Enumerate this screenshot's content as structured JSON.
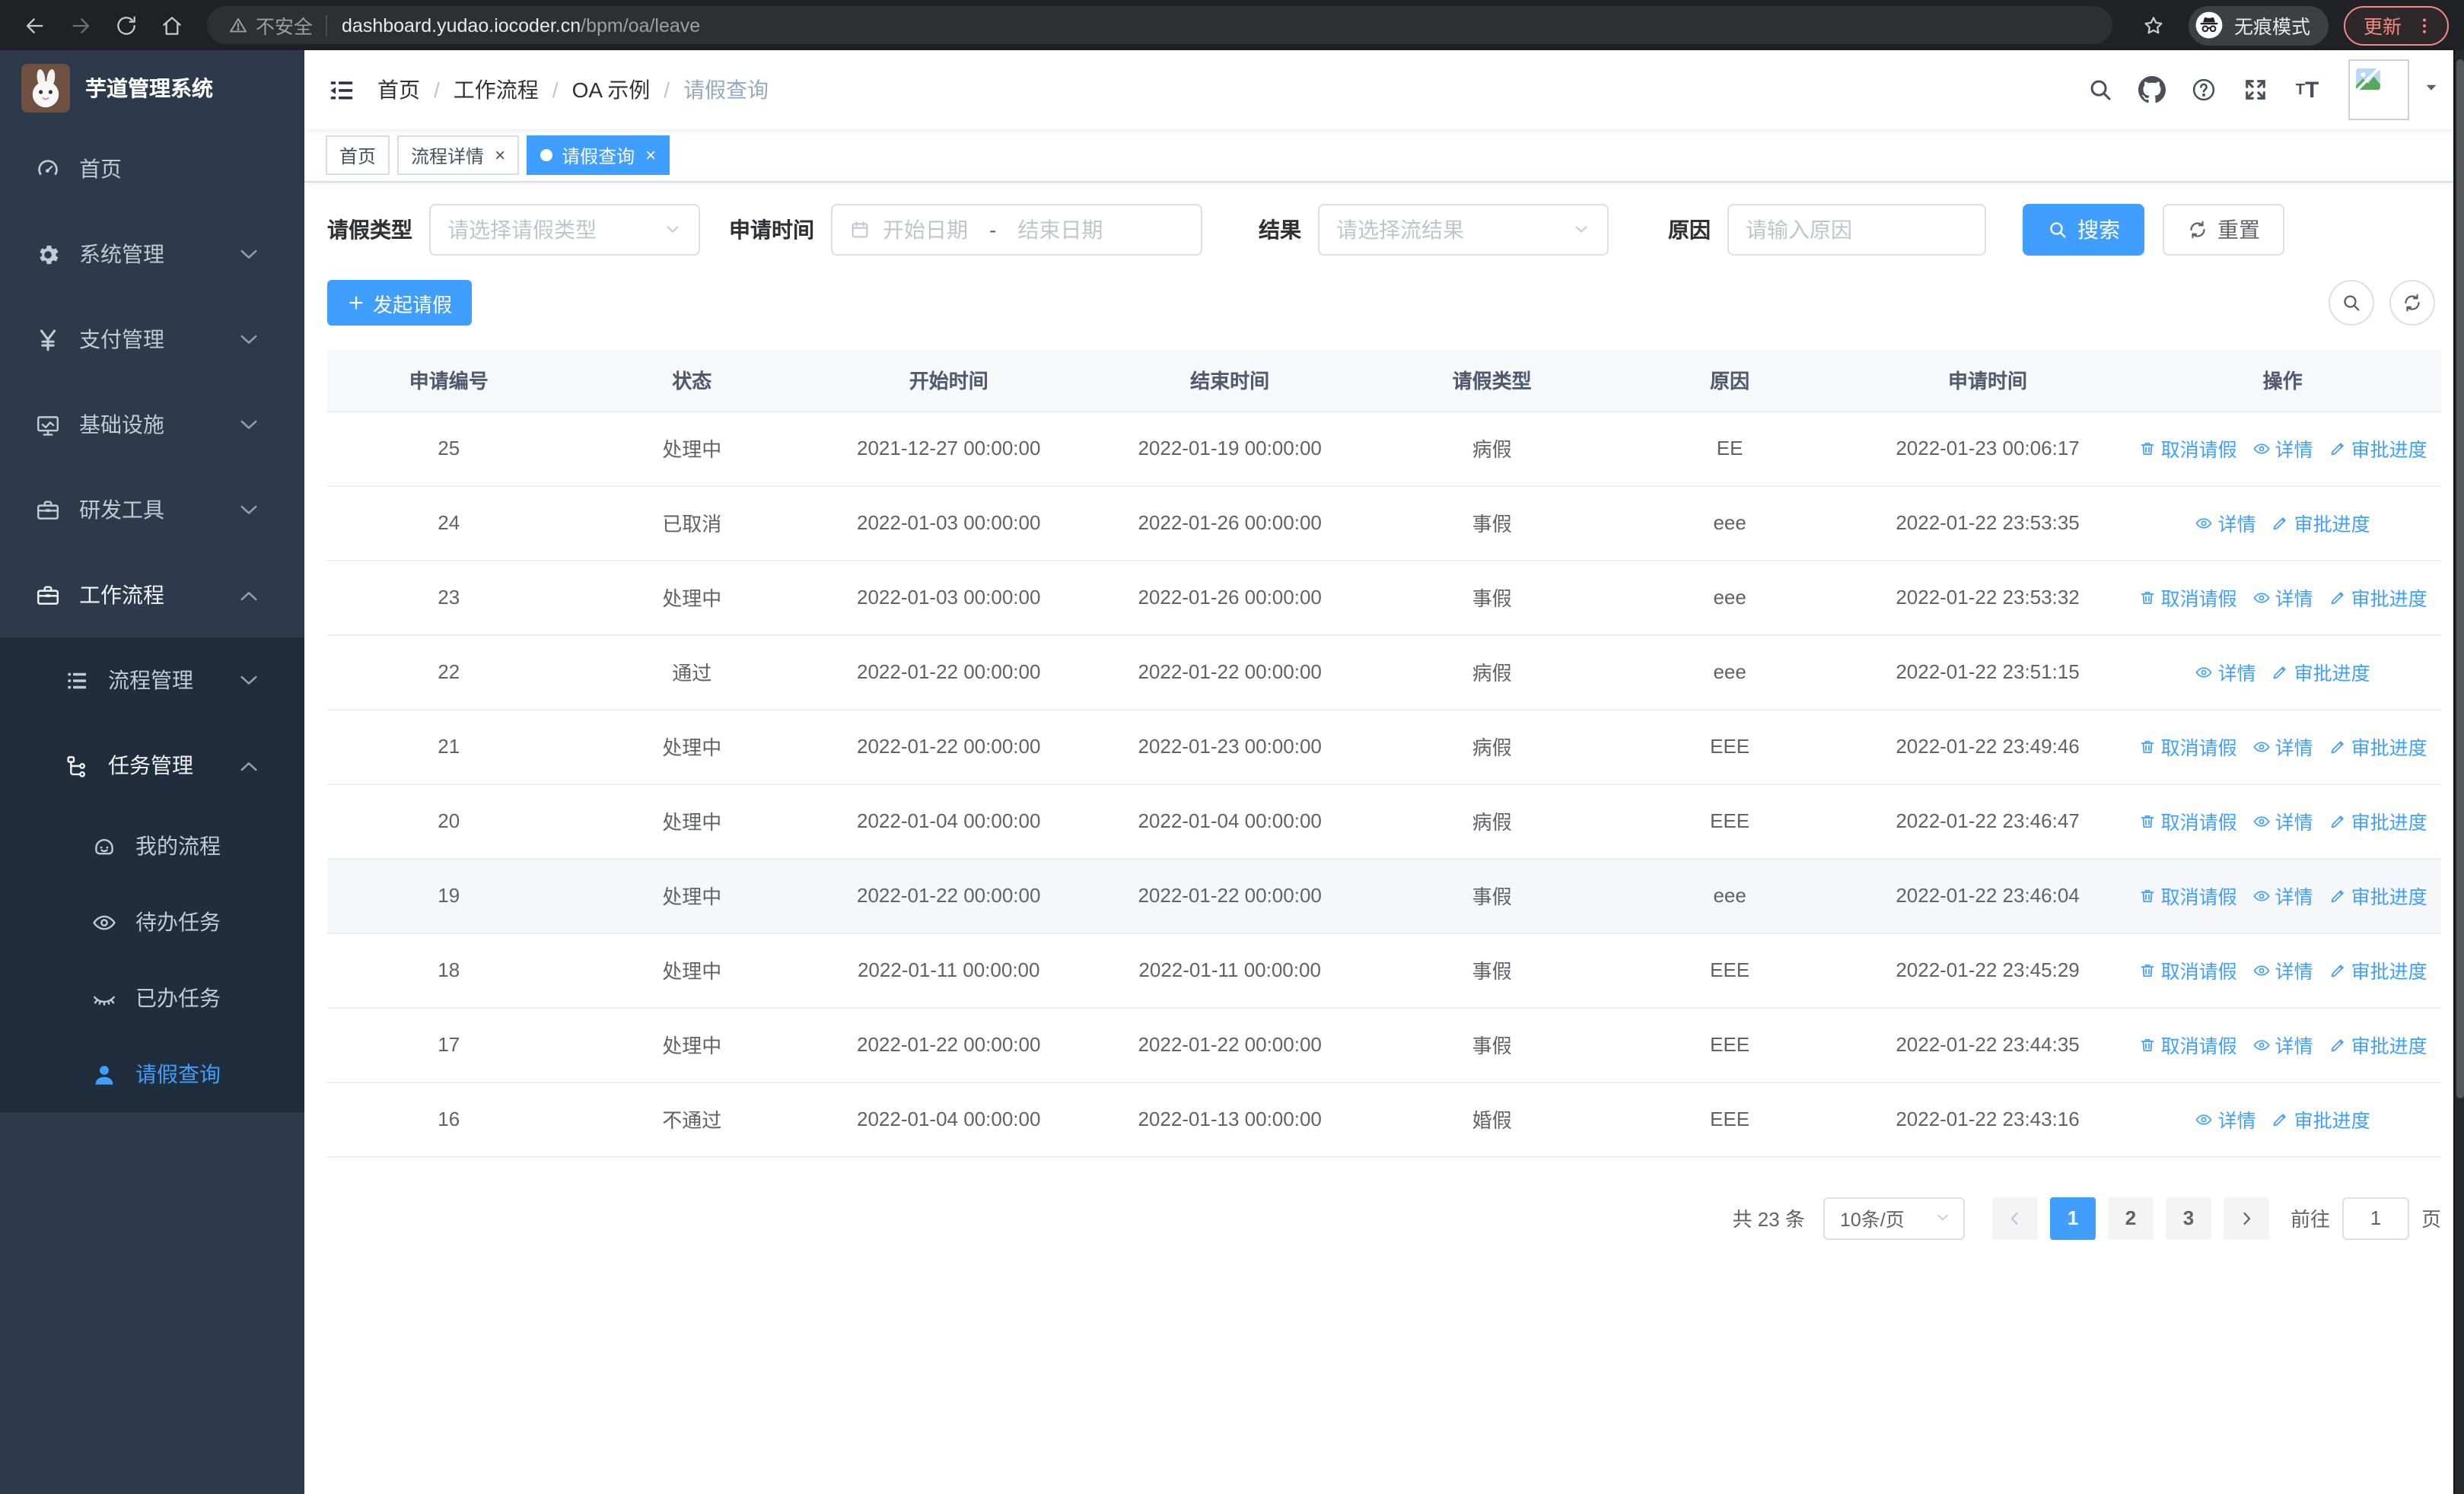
{
  "colors": {
    "primary": "#409eff",
    "sidebar_bg": "#2d3a4b",
    "submenu_bg": "#1f2d3d",
    "update_accent": "#f28b82"
  },
  "browser": {
    "security_label": "不安全",
    "url_host": "dashboard.yudao.iocoder.cn",
    "url_path": "/bpm/oa/leave",
    "incognito_label": "无痕模式",
    "update_label": "更新"
  },
  "sidebar": {
    "logo_title": "芋道管理系统",
    "menu": [
      {
        "key": "home",
        "label": "首页",
        "icon": "gauge-icon"
      },
      {
        "key": "system-management",
        "label": "系统管理",
        "icon": "gear-icon",
        "has_children": true
      },
      {
        "key": "payment-management",
        "label": "支付管理",
        "icon": "yen-icon",
        "has_children": true
      },
      {
        "key": "infrastructure",
        "label": "基础设施",
        "icon": "monitor-icon",
        "has_children": true
      },
      {
        "key": "dev-tools",
        "label": "研发工具",
        "icon": "toolbox-icon",
        "has_children": true
      },
      {
        "key": "workflow",
        "label": "工作流程",
        "icon": "briefcase-icon",
        "has_children": true,
        "open": true,
        "active_trail": true,
        "children": [
          {
            "key": "process-management",
            "label": "流程管理",
            "icon": "list-icon",
            "has_children": true
          },
          {
            "key": "task-management",
            "label": "任务管理",
            "icon": "flow-icon",
            "has_children": true,
            "open": true,
            "active_trail": true,
            "children": [
              {
                "key": "my-process",
                "label": "我的流程",
                "icon": "robot-icon"
              },
              {
                "key": "todo-tasks",
                "label": "待办任务",
                "icon": "eye-icon"
              },
              {
                "key": "done-tasks",
                "label": "已办任务",
                "icon": "eye-closed-icon"
              },
              {
                "key": "leave-query",
                "label": "请假查询",
                "icon": "user-icon",
                "active": true
              }
            ]
          }
        ]
      }
    ]
  },
  "header": {
    "breadcrumb": [
      "首页",
      "工作流程",
      "OA 示例",
      "请假查询"
    ]
  },
  "tabs": [
    {
      "label": "首页",
      "closable": false,
      "active": false
    },
    {
      "label": "流程详情",
      "closable": true,
      "active": false
    },
    {
      "label": "请假查询",
      "closable": true,
      "active": true
    }
  ],
  "filters": {
    "leave_type_label": "请假类型",
    "leave_type_placeholder": "请选择请假类型",
    "apply_time_label": "申请时间",
    "date_start_placeholder": "开始日期",
    "date_separator": "-",
    "date_end_placeholder": "结束日期",
    "result_label": "结果",
    "result_placeholder": "请选择流结果",
    "reason_label": "原因",
    "reason_placeholder": "请输入原因",
    "search_label": "搜索",
    "reset_label": "重置"
  },
  "toolbar": {
    "create_label": "发起请假"
  },
  "table": {
    "columns": [
      "申请编号",
      "状态",
      "开始时间",
      "结束时间",
      "请假类型",
      "原因",
      "申请时间",
      "操作"
    ],
    "action_labels": {
      "cancel": "取消请假",
      "detail": "详情",
      "progress": "审批进度"
    },
    "rows": [
      {
        "id": "25",
        "status": "处理中",
        "start": "2021-12-27 00:00:00",
        "end": "2022-01-19 00:00:00",
        "type": "病假",
        "reason": "EE",
        "apply": "2022-01-23 00:06:17",
        "actions": [
          "cancel",
          "detail",
          "progress"
        ]
      },
      {
        "id": "24",
        "status": "已取消",
        "start": "2022-01-03 00:00:00",
        "end": "2022-01-26 00:00:00",
        "type": "事假",
        "reason": "eee",
        "apply": "2022-01-22 23:53:35",
        "actions": [
          "detail",
          "progress"
        ]
      },
      {
        "id": "23",
        "status": "处理中",
        "start": "2022-01-03 00:00:00",
        "end": "2022-01-26 00:00:00",
        "type": "事假",
        "reason": "eee",
        "apply": "2022-01-22 23:53:32",
        "actions": [
          "cancel",
          "detail",
          "progress"
        ]
      },
      {
        "id": "22",
        "status": "通过",
        "start": "2022-01-22 00:00:00",
        "end": "2022-01-22 00:00:00",
        "type": "病假",
        "reason": "eee",
        "apply": "2022-01-22 23:51:15",
        "actions": [
          "detail",
          "progress"
        ]
      },
      {
        "id": "21",
        "status": "处理中",
        "start": "2022-01-22 00:00:00",
        "end": "2022-01-23 00:00:00",
        "type": "病假",
        "reason": "EEE",
        "apply": "2022-01-22 23:49:46",
        "actions": [
          "cancel",
          "detail",
          "progress"
        ]
      },
      {
        "id": "20",
        "status": "处理中",
        "start": "2022-01-04 00:00:00",
        "end": "2022-01-04 00:00:00",
        "type": "病假",
        "reason": "EEE",
        "apply": "2022-01-22 23:46:47",
        "actions": [
          "cancel",
          "detail",
          "progress"
        ]
      },
      {
        "id": "19",
        "status": "处理中",
        "start": "2022-01-22 00:00:00",
        "end": "2022-01-22 00:00:00",
        "type": "事假",
        "reason": "eee",
        "apply": "2022-01-22 23:46:04",
        "actions": [
          "cancel",
          "detail",
          "progress"
        ],
        "hovered": true
      },
      {
        "id": "18",
        "status": "处理中",
        "start": "2022-01-11 00:00:00",
        "end": "2022-01-11 00:00:00",
        "type": "事假",
        "reason": "EEE",
        "apply": "2022-01-22 23:45:29",
        "actions": [
          "cancel",
          "detail",
          "progress"
        ]
      },
      {
        "id": "17",
        "status": "处理中",
        "start": "2022-01-22 00:00:00",
        "end": "2022-01-22 00:00:00",
        "type": "事假",
        "reason": "EEE",
        "apply": "2022-01-22 23:44:35",
        "actions": [
          "cancel",
          "detail",
          "progress"
        ]
      },
      {
        "id": "16",
        "status": "不通过",
        "start": "2022-01-04 00:00:00",
        "end": "2022-01-13 00:00:00",
        "type": "婚假",
        "reason": "EEE",
        "apply": "2022-01-22 23:43:16",
        "actions": [
          "detail",
          "progress"
        ]
      }
    ]
  },
  "pagination": {
    "total_label": "共 23 条",
    "size_label": "10条/页",
    "pages": [
      "1",
      "2",
      "3"
    ],
    "active_page": "1",
    "goto_prefix": "前往",
    "goto_value": "1",
    "goto_suffix": "页"
  }
}
